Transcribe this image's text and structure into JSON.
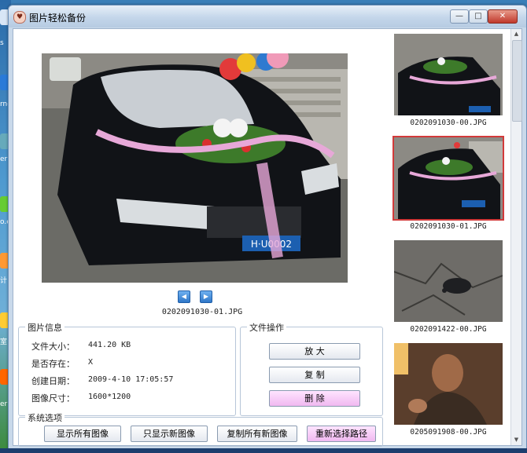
{
  "window": {
    "title": "图片轻松备份",
    "app_icon_glyph": "♥",
    "controls": {
      "minimize": "—",
      "maximize": "□",
      "close": "✕"
    }
  },
  "desktop": {
    "partial_labels": [
      "s",
      "rne",
      "er",
      "o.e",
      "计",
      "室",
      "er"
    ]
  },
  "preview": {
    "filename": "0202091030-01.JPG",
    "prev_icon": "◀",
    "next_icon": "▶",
    "plate_text": "H·U0002"
  },
  "image_info": {
    "title": "图片信息",
    "rows": [
      {
        "label": "文件大小：",
        "value": "441.20 KB"
      },
      {
        "label": "是否存在：",
        "value": "X"
      },
      {
        "label": "创建日期：",
        "value": "2009-4-10 17:05:57"
      },
      {
        "label": "图像尺寸：",
        "value": "1600*1200"
      }
    ]
  },
  "file_ops": {
    "title": "文件操作",
    "zoom": "放    大",
    "copy": "复    制",
    "delete": "删    除"
  },
  "system_options": {
    "title": "系统选项",
    "show_all": "显示所有图像",
    "show_new": "只显示新图像",
    "copy_new": "复制所有新图像",
    "reselect_path": "重新选择路径"
  },
  "thumbnails": [
    {
      "name": "0202091030-00.JPG",
      "selected": false
    },
    {
      "name": "0202091030-01.JPG",
      "selected": true
    },
    {
      "name": "0202091422-00.JPG",
      "selected": false
    },
    {
      "name": "0205091908-00.JPG",
      "selected": false
    }
  ],
  "colors": {
    "accent_selected": "#d23a3a",
    "pink_button": "#f0b8f0",
    "window_bg": "#c9d9ea"
  }
}
